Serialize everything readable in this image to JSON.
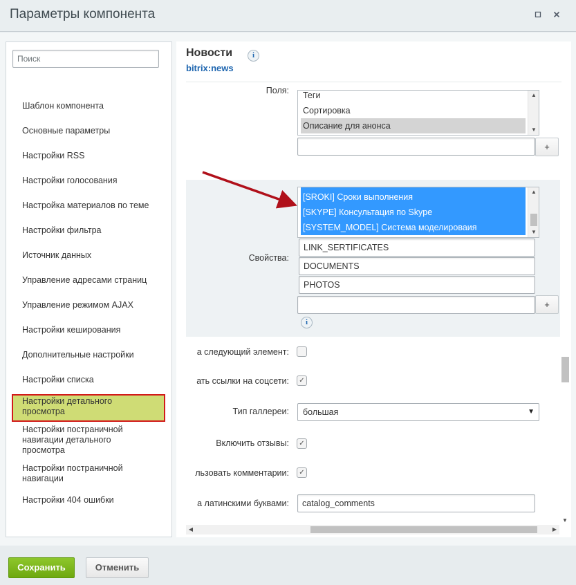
{
  "window": {
    "title": "Параметры компонента",
    "restore_icon": "restore-icon",
    "close_icon": "close-icon"
  },
  "sidebar": {
    "search_placeholder": "Поиск",
    "items": [
      {
        "label": "Шаблон компонента"
      },
      {
        "label": "Основные параметры"
      },
      {
        "label": "Настройки RSS"
      },
      {
        "label": "Настройки голосования"
      },
      {
        "label": "Настройка материалов по теме"
      },
      {
        "label": "Настройки фильтра"
      },
      {
        "label": "Источник данных"
      },
      {
        "label": "Управление адресами страниц"
      },
      {
        "label": "Управление режимом AJAX"
      },
      {
        "label": "Настройки кеширования"
      },
      {
        "label": "Дополнительные настройки"
      },
      {
        "label": "Настройки списка"
      },
      {
        "label": "Настройки детального просмотра",
        "highlighted": true
      },
      {
        "label": "Настройки постраничной навигации детального просмотра"
      },
      {
        "label": "Настройки постраничной навигации"
      },
      {
        "label": "Настройки 404 ошибки"
      }
    ],
    "highlight_color": "#cfdc75",
    "highlight_border": "#d21a1a"
  },
  "component": {
    "title": "Новости",
    "code": "bitrix:news"
  },
  "fields_block": {
    "label_partial": "Поля:",
    "list": [
      "Теги",
      "Сортировка",
      "Описание для анонса"
    ],
    "selected": "Описание для анонса",
    "input_value": "",
    "plus_label": "+"
  },
  "properties_block": {
    "label": "Свойства:",
    "list": [
      "[SROKI] Сроки выполнения",
      "[SKYPE] Консультация по Skype",
      "[SYSTEM_MODEL] Система моделироваия"
    ],
    "inputs": [
      "LINK_SERTIFICATES",
      "DOCUMENTS",
      "PHOTOS",
      ""
    ],
    "plus_label": "+",
    "selection_color": "#3399ff"
  },
  "settings_rows": [
    {
      "label": "а следующий элемент:",
      "type": "checkbox",
      "checked": false
    },
    {
      "label": "ать ссылки на соцсети:",
      "type": "checkbox",
      "checked": true
    },
    {
      "label": "Тип галлереи:",
      "type": "select",
      "value": "большая"
    },
    {
      "label": "Включить отзывы:",
      "type": "checkbox",
      "checked": true
    },
    {
      "label": "льзовать комментарии:",
      "type": "checkbox",
      "checked": true
    },
    {
      "label": "а латинскими буквами:",
      "type": "text",
      "value": "catalog_comments"
    }
  ],
  "footer": {
    "save_label": "Сохранить",
    "cancel_label": "Отменить",
    "save_color": "#7cb81b"
  },
  "annotation": {
    "arrow_color": "#b0101a"
  }
}
